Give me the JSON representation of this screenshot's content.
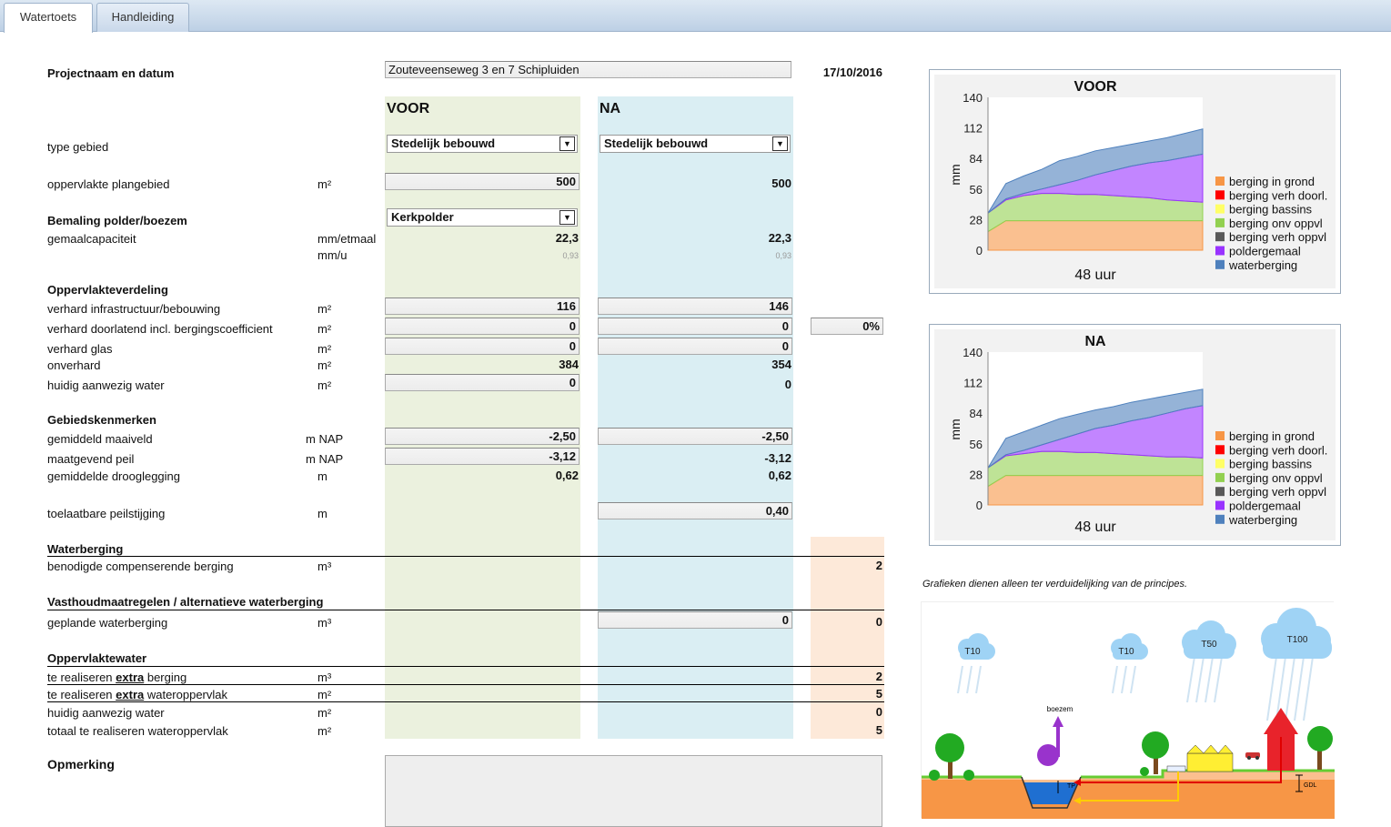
{
  "tabs": [
    {
      "label": "Watertoets",
      "active": true
    },
    {
      "label": "Handleiding",
      "active": false
    }
  ],
  "project": {
    "label": "Projectnaam en datum",
    "name": "Zouteveenseweg 3 en 7 Schipluiden",
    "date": "17/10/2016"
  },
  "columns": {
    "voor": "VOOR",
    "na": "NA"
  },
  "type_gebied": {
    "label": "type gebied",
    "voor": "Stedelijk bebouwd",
    "na": "Stedelijk bebouwd"
  },
  "oppervlakte": {
    "label": "oppervlakte plangebied",
    "unit": "m²",
    "voor": "500",
    "na": "500"
  },
  "bemaling": {
    "label": "Bemaling polder/boezem",
    "value": "Kerkpolder"
  },
  "gemaal": {
    "label": "gemaalcapaciteit",
    "unit1": "mm/etmaal",
    "unit2": "mm/u",
    "voor": "22,3",
    "na": "22,3",
    "voor_u": "0,93",
    "na_u": "0,93"
  },
  "opp_verdeling": {
    "label": "Oppervlakteverdeling"
  },
  "verhard_infra": {
    "label": "verhard infrastructuur/bebouwing",
    "unit": "m²",
    "voor": "116",
    "na": "146"
  },
  "verhard_doorl": {
    "label": "verhard doorlatend incl. bergingscoefficient",
    "unit": "m²",
    "voor": "0",
    "na": "0",
    "pct": "0%"
  },
  "verhard_glas": {
    "label": "verhard glas",
    "unit": "m²",
    "voor": "0",
    "na": "0"
  },
  "onverhard": {
    "label": "onverhard",
    "unit": "m²",
    "voor": "384",
    "na": "354"
  },
  "huidig_water": {
    "label": "huidig aanwezig water",
    "unit": "m²",
    "voor": "0",
    "na": "0"
  },
  "gebied": {
    "label": "Gebiedskenmerken"
  },
  "maaiveld": {
    "label": "gemiddeld maaiveld",
    "unit": "m NAP",
    "voor": "-2,50",
    "na": "-2,50"
  },
  "peil": {
    "label": "maatgevend peil",
    "unit": "m NAP",
    "voor": "-3,12",
    "na": "-3,12"
  },
  "drooglegging": {
    "label": "gemiddelde drooglegging",
    "unit": "m",
    "voor": "0,62",
    "na": "0,62"
  },
  "peilstijging": {
    "label": "toelaatbare peilstijging",
    "unit": "m",
    "na": "0,40"
  },
  "waterberging": {
    "label": "Waterberging",
    "sub_label": "benodigde compenserende berging",
    "unit": "m³",
    "value": "2"
  },
  "vasthoud": {
    "label": "Vasthoudmaatregelen / alternatieve waterberging",
    "sub_label": "geplande waterberging",
    "unit": "m³",
    "na": "0",
    "value": "0"
  },
  "oppwater": {
    "label": "Oppervlaktewater",
    "rows": [
      {
        "pre": "te realiseren ",
        "u": "extra",
        "post": " berging",
        "unit": "m³",
        "value": "2"
      },
      {
        "pre": "te realiseren ",
        "u": "extra",
        "post": " wateroppervlak",
        "unit": "m²",
        "value": "5"
      },
      {
        "pre": "huidig aanwezig water",
        "u": "",
        "post": "",
        "unit": "m²",
        "value": "0"
      },
      {
        "pre": "totaal te realiseren wateroppervlak",
        "u": "",
        "post": "",
        "unit": "m²",
        "value": "5"
      }
    ]
  },
  "opmerking": {
    "label": "Opmerking"
  },
  "colors": {
    "voor_bg": "#ebf1de",
    "na_bg": "#daeef3",
    "result_bg": "#fde9d9"
  },
  "chart_data": [
    {
      "type": "area",
      "title": "VOOR",
      "xlabel": "48 uur",
      "ylabel": "mm",
      "yticks": [
        "140",
        "112",
        "84",
        "56",
        "28",
        "0"
      ],
      "ylim": [
        0,
        140
      ],
      "x": [
        0,
        4,
        8,
        12,
        16,
        20,
        24,
        28,
        32,
        36,
        40,
        44,
        48
      ],
      "series": [
        {
          "name": "berging in grond",
          "color": "#f79646",
          "values": [
            17,
            27,
            27,
            27,
            27,
            27,
            27,
            27,
            27,
            27,
            27,
            27,
            27
          ]
        },
        {
          "name": "berging verh doorl.",
          "color": "#ff0000",
          "values": [
            0,
            0,
            0,
            0,
            0,
            0,
            0,
            0,
            0,
            0,
            0,
            0,
            0
          ]
        },
        {
          "name": "berging bassins",
          "color": "#ffff66",
          "values": [
            0,
            0,
            0,
            0,
            0,
            0,
            0,
            0,
            0,
            0,
            0,
            0,
            0
          ]
        },
        {
          "name": "berging onv oppvl",
          "color": "#92d050",
          "values": [
            17,
            19,
            23,
            25,
            25,
            24,
            24,
            23,
            22,
            21,
            19,
            18,
            17
          ]
        },
        {
          "name": "berging verh oppvl",
          "color": "#595959",
          "values": [
            0,
            0,
            0,
            0,
            0,
            0,
            0,
            0,
            0,
            0,
            0,
            0,
            0
          ]
        },
        {
          "name": "poldergemaal",
          "color": "#9933ff",
          "values": [
            0,
            1,
            2,
            4,
            8,
            13,
            18,
            23,
            28,
            32,
            36,
            40,
            44
          ]
        },
        {
          "name": "waterberging",
          "color": "#4f81bd",
          "values": [
            0,
            14,
            16,
            18,
            22,
            22,
            22,
            21,
            20,
            20,
            21,
            22,
            23
          ]
        }
      ]
    },
    {
      "type": "area",
      "title": "NA",
      "xlabel": "48 uur",
      "ylabel": "mm",
      "yticks": [
        "140",
        "112",
        "84",
        "56",
        "28",
        "0"
      ],
      "ylim": [
        0,
        140
      ],
      "x": [
        0,
        4,
        8,
        12,
        16,
        20,
        24,
        28,
        32,
        36,
        40,
        44,
        48
      ],
      "series": [
        {
          "name": "berging in grond",
          "color": "#f79646",
          "values": [
            17,
            27,
            27,
            27,
            27,
            27,
            27,
            27,
            27,
            27,
            27,
            27,
            27
          ]
        },
        {
          "name": "berging verh doorl.",
          "color": "#ff0000",
          "values": [
            0,
            0,
            0,
            0,
            0,
            0,
            0,
            0,
            0,
            0,
            0,
            0,
            0
          ]
        },
        {
          "name": "berging bassins",
          "color": "#ffff66",
          "values": [
            0,
            0,
            0,
            0,
            0,
            0,
            0,
            0,
            0,
            0,
            0,
            0,
            0
          ]
        },
        {
          "name": "berging onv oppvl",
          "color": "#92d050",
          "values": [
            17,
            18,
            20,
            22,
            22,
            21,
            21,
            20,
            19,
            18,
            17,
            17,
            16
          ]
        },
        {
          "name": "berging verh oppvl",
          "color": "#595959",
          "values": [
            0,
            0,
            0,
            0,
            0,
            0,
            0,
            0,
            0,
            0,
            0,
            0,
            0
          ]
        },
        {
          "name": "poldergemaal",
          "color": "#9933ff",
          "values": [
            0,
            1,
            3,
            6,
            11,
            17,
            22,
            26,
            31,
            35,
            40,
            44,
            48
          ]
        },
        {
          "name": "waterberging",
          "color": "#4f81bd",
          "values": [
            0,
            15,
            17,
            18,
            19,
            18,
            17,
            17,
            17,
            17,
            16,
            15,
            15
          ]
        }
      ]
    }
  ],
  "chart_note": "Grafieken dienen alleen ter verduidelijking van de principes.",
  "illustration": {
    "clouds": [
      "T10",
      "T10",
      "T50",
      "T100"
    ],
    "boezem": "boezem",
    "tp": "TP",
    "gdl": "GDL"
  }
}
